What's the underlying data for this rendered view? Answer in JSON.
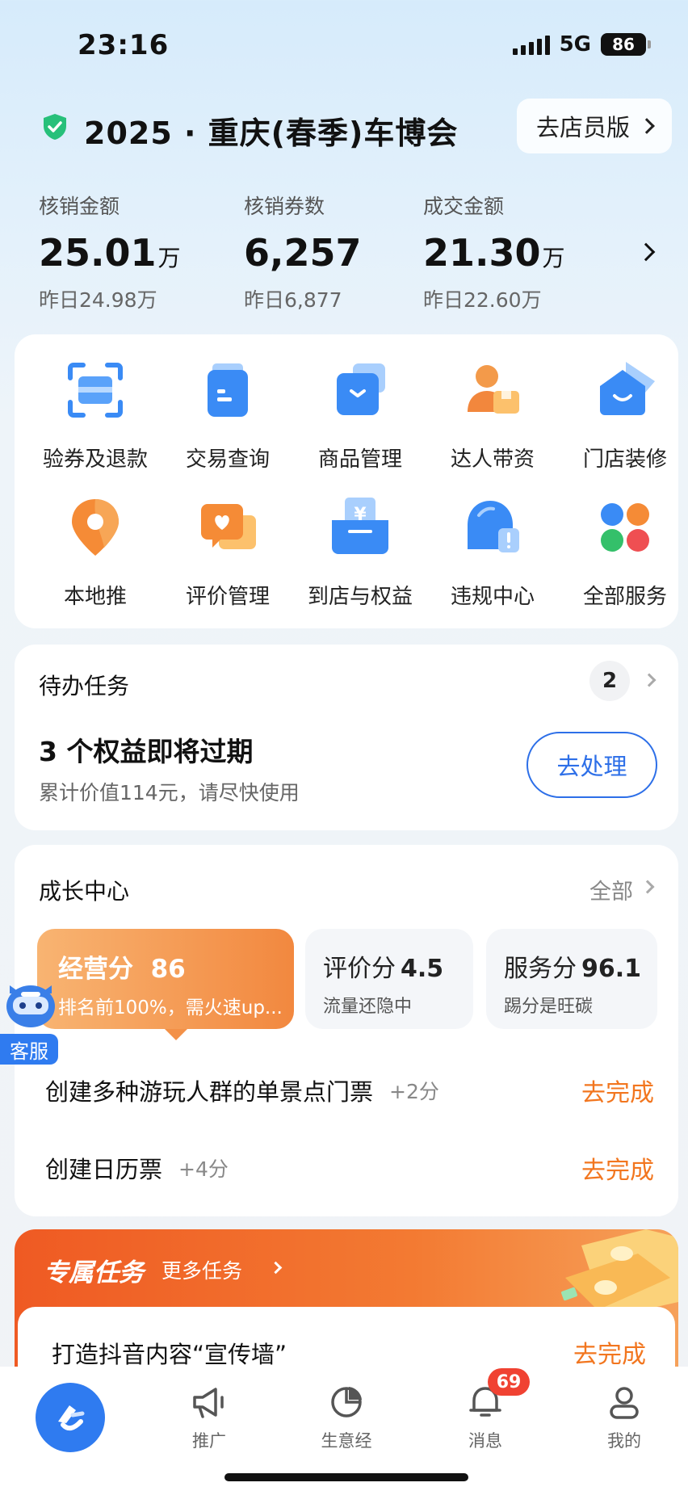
{
  "status_bar": {
    "time": "23:16",
    "network": "5G",
    "battery": "86"
  },
  "header": {
    "title": "2025 · 重庆(春季)车博会",
    "staff_button": "去店员版"
  },
  "stats": [
    {
      "label": "核销金额",
      "value": "25.01",
      "unit": "万",
      "prev": "昨日24.98万"
    },
    {
      "label": "核销券数",
      "value": "6,257",
      "unit": "",
      "prev": "昨日6,877"
    },
    {
      "label": "成交金额",
      "value": "21.30",
      "unit": "万",
      "prev": "昨日22.60万"
    }
  ],
  "services": [
    {
      "label": "验券及退款",
      "icon": "scan-icon"
    },
    {
      "label": "交易查询",
      "icon": "document-icon"
    },
    {
      "label": "商品管理",
      "icon": "box-icon"
    },
    {
      "label": "达人带资",
      "icon": "person-icon"
    },
    {
      "label": "门店装修",
      "icon": "house-icon"
    },
    {
      "label": "本地推",
      "icon": "location-icon"
    },
    {
      "label": "评价管理",
      "icon": "review-icon"
    },
    {
      "label": "到店与权益",
      "icon": "yuan-icon"
    },
    {
      "label": "违规中心",
      "icon": "alert-icon"
    },
    {
      "label": "全部服务",
      "icon": "grid-icon"
    }
  ],
  "todo": {
    "title": "待办任务",
    "count": "2",
    "main": "3 个权益即将过期",
    "sub": "累计价值114元，请尽快使用",
    "button": "去处理"
  },
  "growth": {
    "title": "成长中心",
    "all": "全部",
    "scores": [
      {
        "name": "经营分",
        "value": "86",
        "desc": "排名前100%，需火速up..."
      },
      {
        "name": "评价分",
        "value": "4.5",
        "desc": "流量还隐中"
      },
      {
        "name": "服务分",
        "value": "96.1",
        "desc": "踢分是旺碳"
      }
    ],
    "tasks": [
      {
        "name": "创建多种游玩人群的单景点门票",
        "points": "+2分",
        "action": "去完成"
      },
      {
        "name": "创建日历票",
        "points": "+4分",
        "action": "去完成"
      }
    ]
  },
  "exclusive": {
    "title": "专属任务",
    "more": "更多任务",
    "task": "打造抖音内容“宣传墙”",
    "action": "去完成"
  },
  "customer_service": {
    "label": "客服"
  },
  "bottom_nav": [
    {
      "label": "推广",
      "icon": "megaphone-icon"
    },
    {
      "label": "生意经",
      "icon": "pie-chart-icon"
    },
    {
      "label": "消息",
      "icon": "bell-icon",
      "badge": "69"
    },
    {
      "label": "我的",
      "icon": "user-icon"
    }
  ],
  "colors": {
    "accent_blue": "#2f7bf0",
    "accent_orange": "#f2761f",
    "badge_red": "#f04232"
  }
}
